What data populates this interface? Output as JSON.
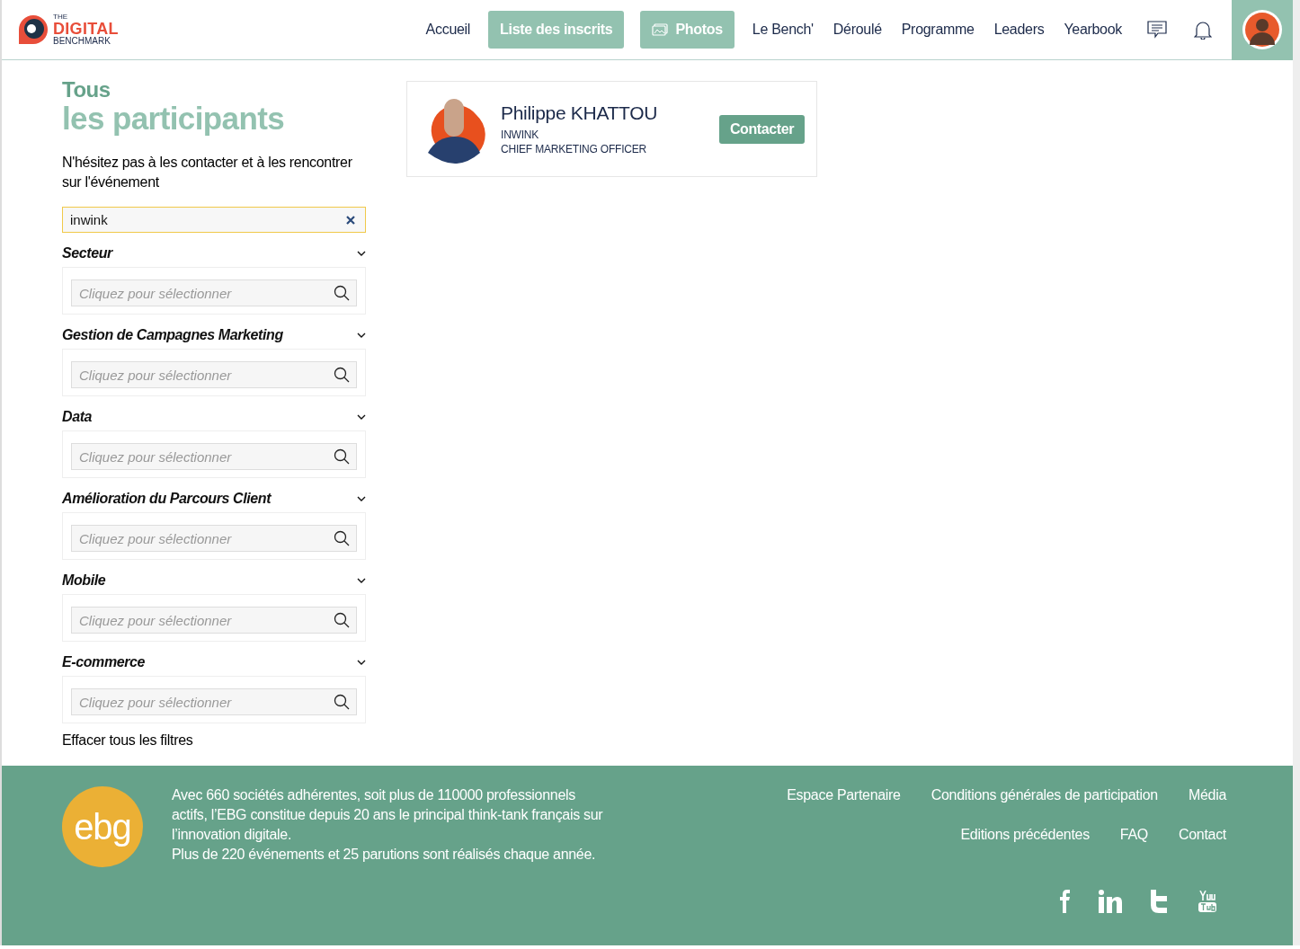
{
  "logo": {
    "small": "THE",
    "main": "DIGITAL",
    "sub": "BENCHMARK"
  },
  "nav": [
    {
      "label": "Accueil",
      "highlighted": false,
      "icon": false
    },
    {
      "label": "Liste des inscrits",
      "highlighted": true,
      "icon": false
    },
    {
      "label": "Photos",
      "highlighted": true,
      "icon": true
    },
    {
      "label": "Le Bench'",
      "highlighted": false,
      "icon": false
    },
    {
      "label": "Déroulé",
      "highlighted": false,
      "icon": false
    },
    {
      "label": "Programme",
      "highlighted": false,
      "icon": false
    },
    {
      "label": "Leaders",
      "highlighted": false,
      "icon": false
    },
    {
      "label": "Yearbook",
      "highlighted": false,
      "icon": false
    }
  ],
  "heading": {
    "line1": "Tous",
    "line2": "les participants"
  },
  "intro": "N'hésitez pas à les contacter et à les rencontrer sur l'événement",
  "search": {
    "value": "inwink"
  },
  "filters": [
    {
      "title": "Secteur",
      "placeholder": "Cliquez pour sélectionner"
    },
    {
      "title": "Gestion de Campagnes Marketing",
      "placeholder": "Cliquez pour sélectionner"
    },
    {
      "title": "Data",
      "placeholder": "Cliquez pour sélectionner"
    },
    {
      "title": "Amélioration du Parcours Client",
      "placeholder": "Cliquez pour sélectionner"
    },
    {
      "title": "Mobile",
      "placeholder": "Cliquez pour sélectionner"
    },
    {
      "title": "E-commerce",
      "placeholder": "Cliquez pour sélectionner"
    }
  ],
  "clear_filters": "Effacer tous les filtres",
  "participants": [
    {
      "name": "Philippe KHATTOU",
      "company": "INWINK",
      "role": "CHIEF MARKETING OFFICER",
      "button": "Contacter"
    }
  ],
  "footer": {
    "logo": "ebg",
    "text": "Avec 660 sociétés adhérentes, soit plus de 110000 professionnels actifs, l’EBG constitue depuis 20 ans le principal think-tank français sur l’innovation digitale.",
    "text2": "Plus de 220 événements et 25 parutions sont réalisés chaque année.",
    "links_row1": [
      "Espace Partenaire",
      "Conditions générales de participation",
      "Média"
    ],
    "links_row2": [
      "Editions précédentes",
      "FAQ",
      "Contact"
    ]
  }
}
